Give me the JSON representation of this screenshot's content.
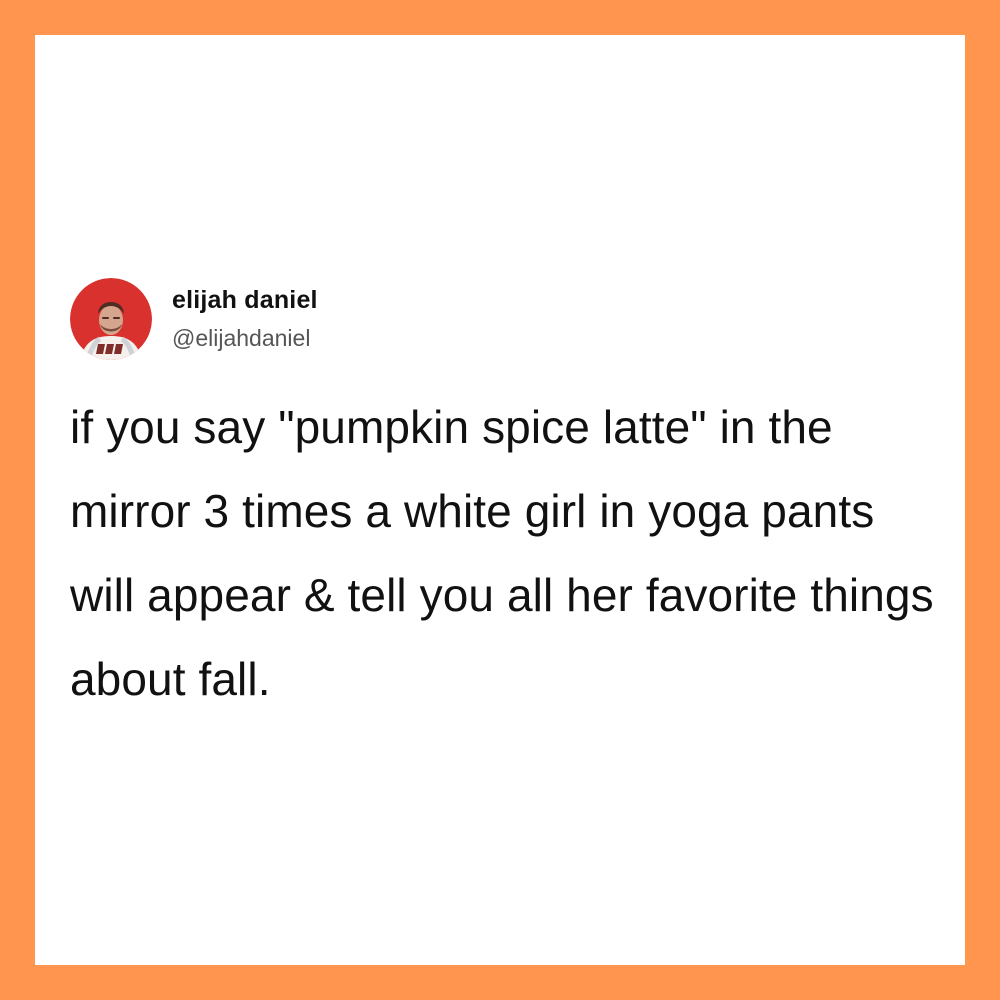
{
  "colors": {
    "frame_border": "#FF954F",
    "card_background": "#FFFFFF",
    "text_primary": "#111111",
    "text_secondary": "#555555"
  },
  "post": {
    "author": {
      "display_name": "elijah daniel",
      "handle": "@elijahdaniel",
      "avatar_icon": "profile-photo-avatar"
    },
    "text": "if you say \"pumpkin spice latte\" in the mirror 3 times a white girl in yoga pants will appear & tell you all her favorite things about fall."
  }
}
